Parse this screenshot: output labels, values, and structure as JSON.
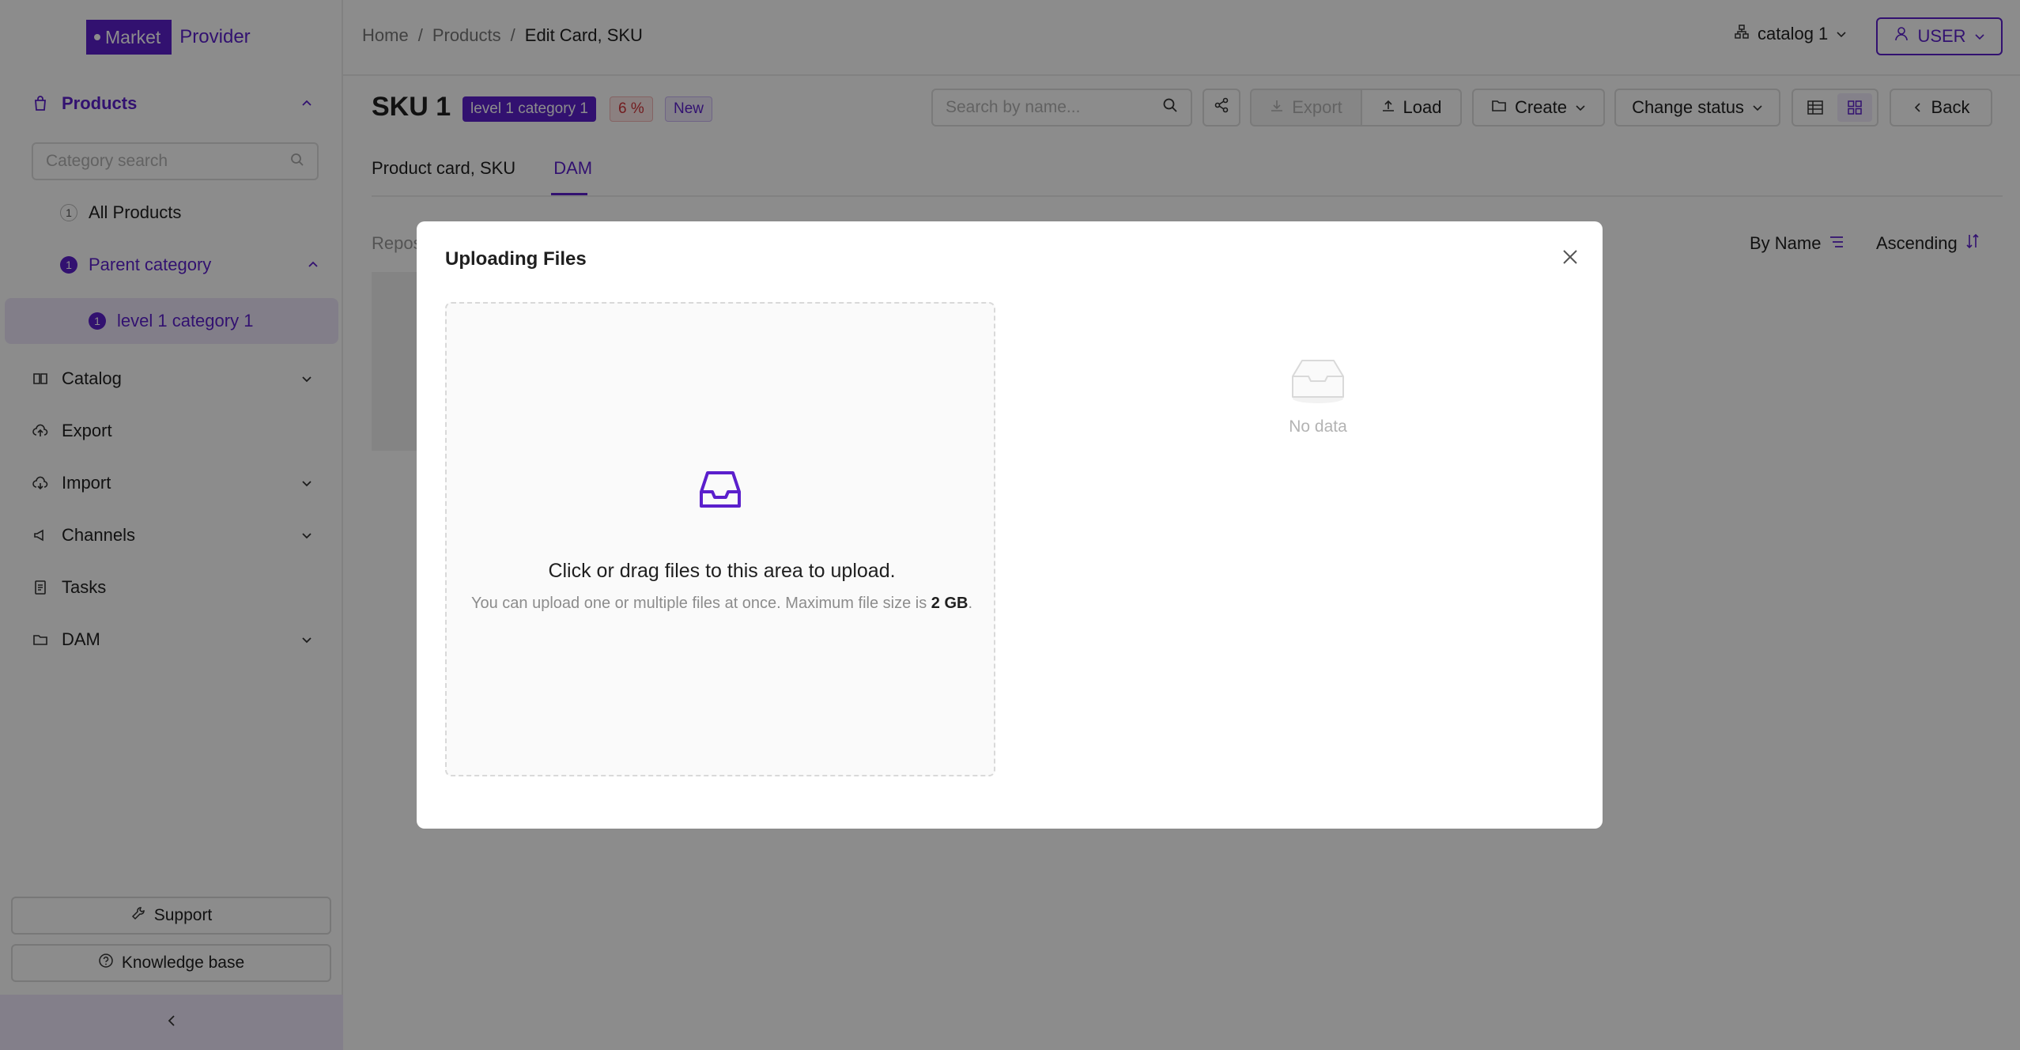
{
  "app": {
    "logo_market": "Market",
    "logo_provider": "Provider",
    "accent_color": "#5b1fcc"
  },
  "sidebar": {
    "products_label": "Products",
    "category_search_placeholder": "Category search",
    "all_products": {
      "count": "1",
      "label": "All Products"
    },
    "parent_category": {
      "count": "1",
      "label": "Parent category"
    },
    "level1_category": {
      "count": "1",
      "label": "level 1 category 1"
    },
    "items": [
      {
        "label": "Catalog",
        "icon": "book-icon",
        "expandable": true
      },
      {
        "label": "Export",
        "icon": "cloud-upload-icon",
        "expandable": false
      },
      {
        "label": "Import",
        "icon": "cloud-download-icon",
        "expandable": true
      },
      {
        "label": "Channels",
        "icon": "megaphone-icon",
        "expandable": true
      },
      {
        "label": "Tasks",
        "icon": "clipboard-icon",
        "expandable": false
      },
      {
        "label": "DAM",
        "icon": "folder-icon",
        "expandable": true
      }
    ],
    "support_label": "Support",
    "knowledge_base_label": "Knowledge base"
  },
  "header": {
    "breadcrumb": [
      "Home",
      "Products",
      "Edit Card, SKU"
    ],
    "catalog_selector": "catalog 1",
    "user_label": "USER"
  },
  "page": {
    "title": "SKU 1",
    "tags": {
      "category": "level 1 category 1",
      "percent": "6 %",
      "status": "New"
    },
    "search_placeholder": "Search by name...",
    "toolbar": {
      "export": "Export",
      "load": "Load",
      "create": "Create",
      "change_status": "Change status",
      "back": "Back"
    },
    "tabs": [
      "Product card, SKU",
      "DAM"
    ],
    "active_tab": "DAM",
    "repository_label": "Repos",
    "sort_field": "By Name",
    "sort_direction": "Ascending"
  },
  "modal": {
    "title": "Uploading Files",
    "dropzone_text": "Click or drag files to this area to upload.",
    "dropzone_hint_prefix": "You can upload one or multiple files at once. Maximum file size is ",
    "dropzone_hint_size": "2 GB",
    "dropzone_hint_suffix": ".",
    "empty_text": "No data"
  }
}
